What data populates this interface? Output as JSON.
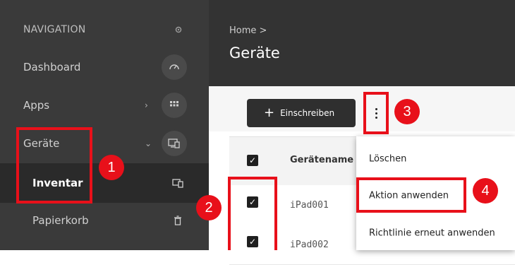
{
  "sidebar": {
    "header": "NAVIGATION",
    "items": [
      {
        "label": "Dashboard",
        "icon": "gauge-icon"
      },
      {
        "label": "Apps",
        "icon": "grid-icon"
      },
      {
        "label": "Geräte",
        "icon": "devices-icon"
      },
      {
        "label": "Inventar",
        "icon": "inventory-icon"
      },
      {
        "label": "Papierkorb",
        "icon": "trash-icon"
      }
    ]
  },
  "header": {
    "breadcrumb": "Home >",
    "title": "Geräte"
  },
  "toolbar": {
    "enroll_plus": "+",
    "enroll_label": "Einschreiben",
    "more_icon": "kebab-menu-icon"
  },
  "table": {
    "column_header": "Gerätename",
    "rows": [
      {
        "name": "iPad001",
        "checked": true
      },
      {
        "name": "iPad002",
        "checked": true
      }
    ]
  },
  "menu": {
    "items": [
      "Löschen",
      "Aktion anwenden",
      "Richtlinie erneut anwenden"
    ]
  },
  "annotations": {
    "steps": [
      "1",
      "2",
      "3",
      "4"
    ],
    "color": "#e8101a"
  },
  "colors": {
    "sidebar_bg": "#3a3a3a",
    "header_bg": "#333333",
    "primary_button": "#2f2f2f"
  }
}
